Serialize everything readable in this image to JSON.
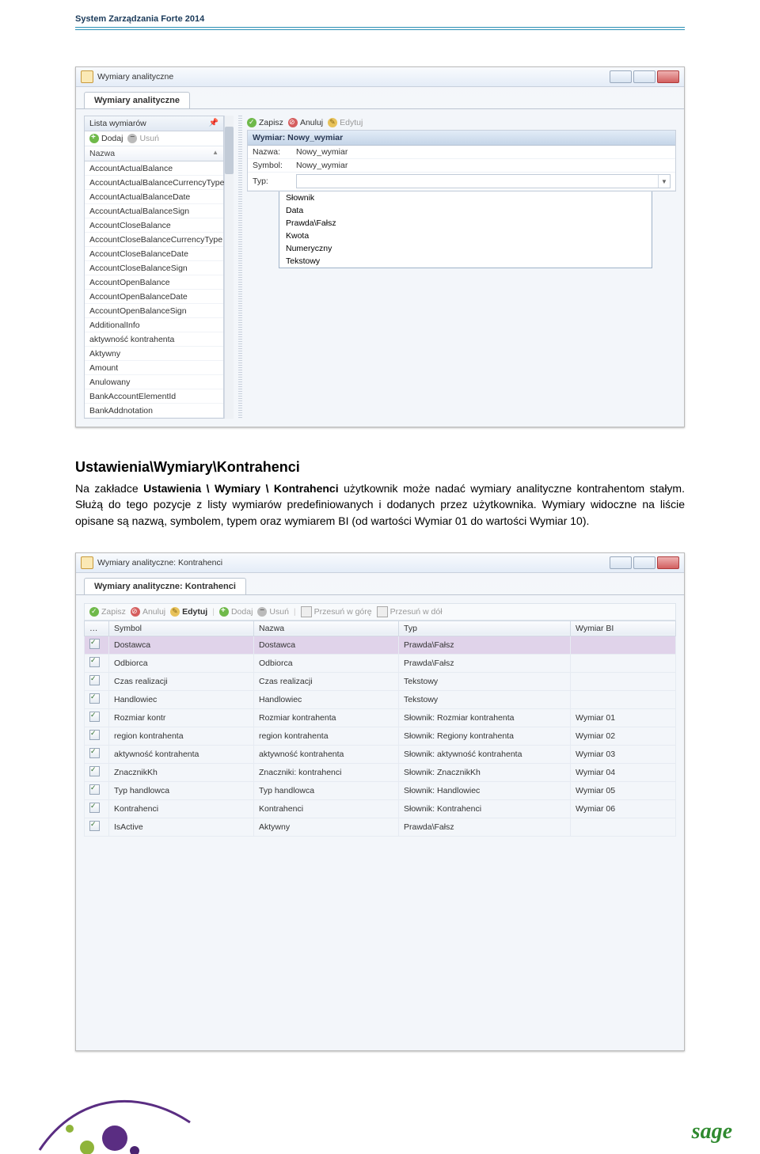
{
  "page_header": "System Zarządzania Forte 2014",
  "screenshot1": {
    "window_title": "Wymiary analityczne",
    "tab_label": "Wymiary analityczne",
    "left_panel_title": "Lista wymiarów",
    "btn_add": "Dodaj",
    "btn_remove": "Usuń",
    "col_name": "Nazwa",
    "items": [
      "AccountActualBalance",
      "AccountActualBalanceCurrencyType",
      "AccountActualBalanceDate",
      "AccountActualBalanceSign",
      "AccountCloseBalance",
      "AccountCloseBalanceCurrencyType",
      "AccountCloseBalanceDate",
      "AccountCloseBalanceSign",
      "AccountOpenBalance",
      "AccountOpenBalanceDate",
      "AccountOpenBalanceSign",
      "AdditionalInfo",
      "aktywność kontrahenta",
      "Aktywny",
      "Amount",
      "Anulowany",
      "BankAccountElementId",
      "BankAddnotation"
    ],
    "btn_save": "Zapisz",
    "btn_cancel": "Anuluj",
    "btn_edit": "Edytuj",
    "detail_header": "Wymiar: Nowy_wymiar",
    "kv_name_label": "Nazwa:",
    "kv_name_value": "Nowy_wymiar",
    "kv_symbol_label": "Symbol:",
    "kv_symbol_value": "Nowy_wymiar",
    "kv_type_label": "Typ:",
    "type_options": [
      "Słownik",
      "Data",
      "Prawda\\Fałsz",
      "Kwota",
      "Numeryczny",
      "Tekstowy"
    ]
  },
  "prose": {
    "heading": "Ustawienia\\Wymiary\\Kontrahenci",
    "p_pre": "Na zakładce ",
    "p_bold": "Ustawienia \\ Wymiary \\ Kontrahenci",
    "p_post": " użytkownik może nadać wymiary analityczne kontrahentom stałym. Służą do tego pozycje z listy wymiarów predefiniowanych i dodanych przez użytkownika. Wymiary widoczne na liście opisane są nazwą, symbolem, typem oraz wymiarem BI (od wartości Wymiar 01 do wartości Wymiar 10)."
  },
  "screenshot2": {
    "window_title": "Wymiary analityczne: Kontrahenci",
    "tab_label": "Wymiary analityczne: Kontrahenci",
    "btn_save": "Zapisz",
    "btn_cancel": "Anuluj",
    "btn_edit": "Edytuj",
    "btn_add": "Dodaj",
    "btn_remove": "Usuń",
    "btn_up": "Przesuń w górę",
    "btn_down": "Przesuń w dół",
    "cols": {
      "c0": "…",
      "c1": "Symbol",
      "c2": "Nazwa",
      "c3": "Typ",
      "c4": "Wymiar BI"
    },
    "rows": [
      {
        "sym": "Dostawca",
        "naz": "Dostawca",
        "typ": "Prawda\\Fałsz",
        "bi": ""
      },
      {
        "sym": "Odbiorca",
        "naz": "Odbiorca",
        "typ": "Prawda\\Fałsz",
        "bi": ""
      },
      {
        "sym": "Czas realizacji",
        "naz": "Czas realizacji",
        "typ": "Tekstowy",
        "bi": ""
      },
      {
        "sym": "Handlowiec",
        "naz": "Handlowiec",
        "typ": "Tekstowy",
        "bi": ""
      },
      {
        "sym": "Rozmiar kontr",
        "naz": "Rozmiar kontrahenta",
        "typ": "Słownik: Rozmiar kontrahenta",
        "bi": "Wymiar 01"
      },
      {
        "sym": "region kontrahenta",
        "naz": "region kontrahenta",
        "typ": "Słownik: Regiony kontrahenta",
        "bi": "Wymiar 02"
      },
      {
        "sym": "aktywność kontrahenta",
        "naz": "aktywność kontrahenta",
        "typ": "Słownik: aktywność kontrahenta",
        "bi": "Wymiar 03"
      },
      {
        "sym": "ZnacznikKh",
        "naz": "Znaczniki: kontrahenci",
        "typ": "Słownik: ZnacznikKh",
        "bi": "Wymiar 04"
      },
      {
        "sym": "Typ handlowca",
        "naz": "Typ handlowca",
        "typ": "Słownik: Handlowiec",
        "bi": "Wymiar 05"
      },
      {
        "sym": "Kontrahenci",
        "naz": "Kontrahenci",
        "typ": "Słownik: Kontrahenci",
        "bi": "Wymiar 06"
      },
      {
        "sym": "IsActive",
        "naz": "Aktywny",
        "typ": "Prawda\\Fałsz",
        "bi": ""
      }
    ]
  },
  "logo": "sage"
}
